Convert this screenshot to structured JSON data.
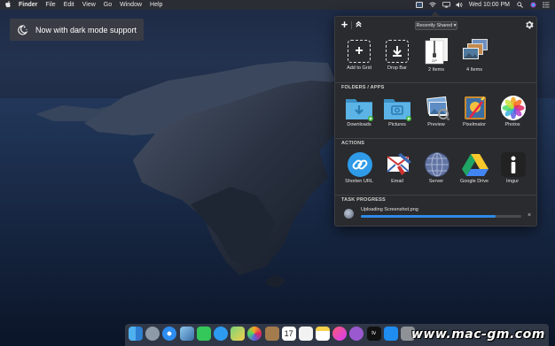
{
  "menubar": {
    "app_name": "Finder",
    "menus": [
      "File",
      "Edit",
      "View",
      "Go",
      "Window",
      "Help"
    ],
    "clock": "Wed 10:00 PM",
    "status_icons": [
      "app-status-icon",
      "wifi-icon",
      "airplay-icon",
      "volume-icon",
      "search-icon",
      "siri-icon",
      "control-list-icon"
    ]
  },
  "badge": {
    "text": "Now with dark mode support"
  },
  "panel": {
    "dropdown_label": "Recently Shared ▾",
    "top_row": [
      {
        "label": "Add to Grid"
      },
      {
        "label": "Drop Bar"
      },
      {
        "label": "2 Items"
      },
      {
        "label": "4 Items"
      }
    ],
    "folders_title": "FOLDERS / APPS",
    "folders": [
      {
        "label": "Downloads"
      },
      {
        "label": "Pictures"
      },
      {
        "label": "Preview"
      },
      {
        "label": "Pixelmator"
      },
      {
        "label": "Photos"
      }
    ],
    "actions_title": "ACTIONS",
    "actions": [
      {
        "label": "Shorten URL"
      },
      {
        "label": "Email"
      },
      {
        "label": "Server"
      },
      {
        "label": "Google Drive"
      },
      {
        "label": "Imgur"
      }
    ],
    "task_title": "TASK PROGRESS",
    "task": {
      "filename": "Uploading Screenshot.png",
      "progress": 0.84
    }
  },
  "dock": {
    "calendar_day": "17",
    "watermark": "www.mac-gm.com"
  }
}
